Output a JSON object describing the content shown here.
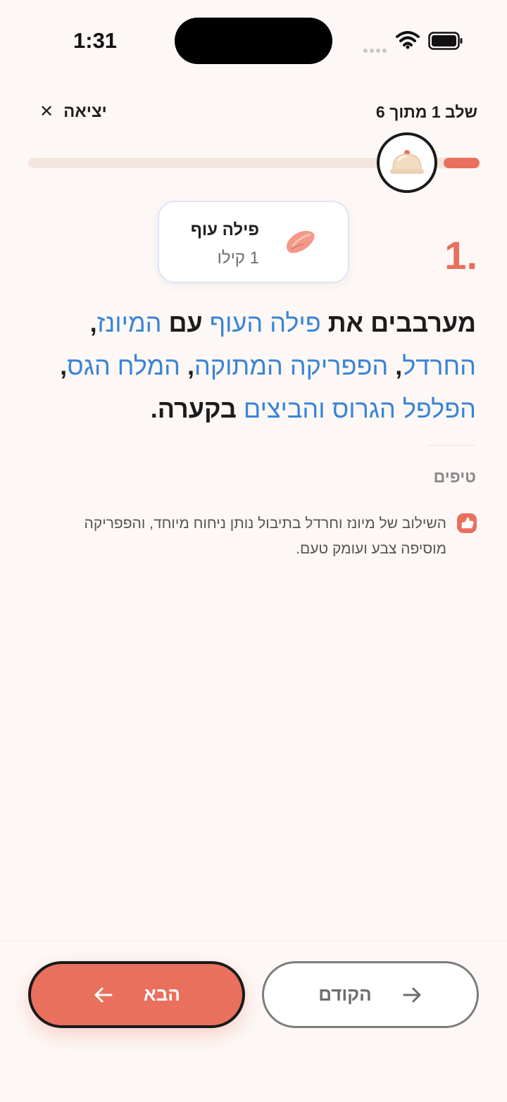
{
  "status_bar": {
    "time": "1:31"
  },
  "header": {
    "step_label": "שלב 1 מתוך 6",
    "exit_label": "יציאה"
  },
  "progress": {
    "current_step": 1,
    "total_steps": 6,
    "fraction": 0.08,
    "knob_icon": "serving-cloche-icon"
  },
  "ingredient_card": {
    "name": "פילה עוף",
    "quantity": "1 קילו",
    "icon": "chicken-breast-icon"
  },
  "step": {
    "number": "1.",
    "instruction_parts": [
      {
        "text": "מערבבים את ",
        "type": "text"
      },
      {
        "text": "פילה העוף",
        "type": "ingredient"
      },
      {
        "text": " עם ",
        "type": "text"
      },
      {
        "text": "המיונז",
        "type": "ingredient"
      },
      {
        "text": ", ",
        "type": "text"
      },
      {
        "text": "החרדל",
        "type": "ingredient"
      },
      {
        "text": ", ",
        "type": "text"
      },
      {
        "text": "הפפריקה המתוקה",
        "type": "ingredient"
      },
      {
        "text": ", ",
        "type": "text"
      },
      {
        "text": "המלח הגס",
        "type": "ingredient"
      },
      {
        "text": ", ",
        "type": "text"
      },
      {
        "text": "הפלפל הגרוס",
        "type": "ingredient"
      },
      {
        "text": " ",
        "type": "text"
      },
      {
        "text": "והביצים",
        "type": "ingredient"
      },
      {
        "text": " בקערה.",
        "type": "text"
      }
    ]
  },
  "tips": {
    "title": "טיפים",
    "items": [
      {
        "icon": "thumbs-up-icon",
        "text": "השילוב של מיונז וחרדל בתיבול נותן ניחוח מיוחד, והפפריקה מוסיפה צבע ועומק טעם."
      }
    ]
  },
  "footer": {
    "next_label": "הבא",
    "prev_label": "הקודם"
  },
  "colors": {
    "accent": "#e8705d",
    "ingredient_link": "#3a84d6",
    "background": "#fdf8f6"
  }
}
